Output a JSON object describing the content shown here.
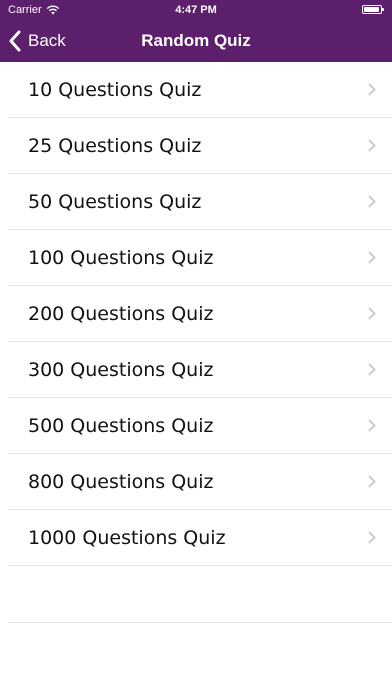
{
  "status_bar": {
    "carrier": "Carrier",
    "time": "4:47 PM"
  },
  "nav": {
    "back_label": "Back",
    "title": "Random Quiz"
  },
  "colors": {
    "header_bg": "#5b1f6b",
    "separator": "#e4e4e4",
    "chevron": "#c7c7cc"
  },
  "quiz_list": {
    "items": [
      {
        "label": "10 Questions Quiz"
      },
      {
        "label": "25 Questions Quiz"
      },
      {
        "label": "50 Questions Quiz"
      },
      {
        "label": "100 Questions Quiz"
      },
      {
        "label": "200 Questions Quiz"
      },
      {
        "label": "300 Questions Quiz"
      },
      {
        "label": "500 Questions Quiz"
      },
      {
        "label": "800 Questions Quiz"
      },
      {
        "label": "1000 Questions Quiz"
      }
    ]
  }
}
